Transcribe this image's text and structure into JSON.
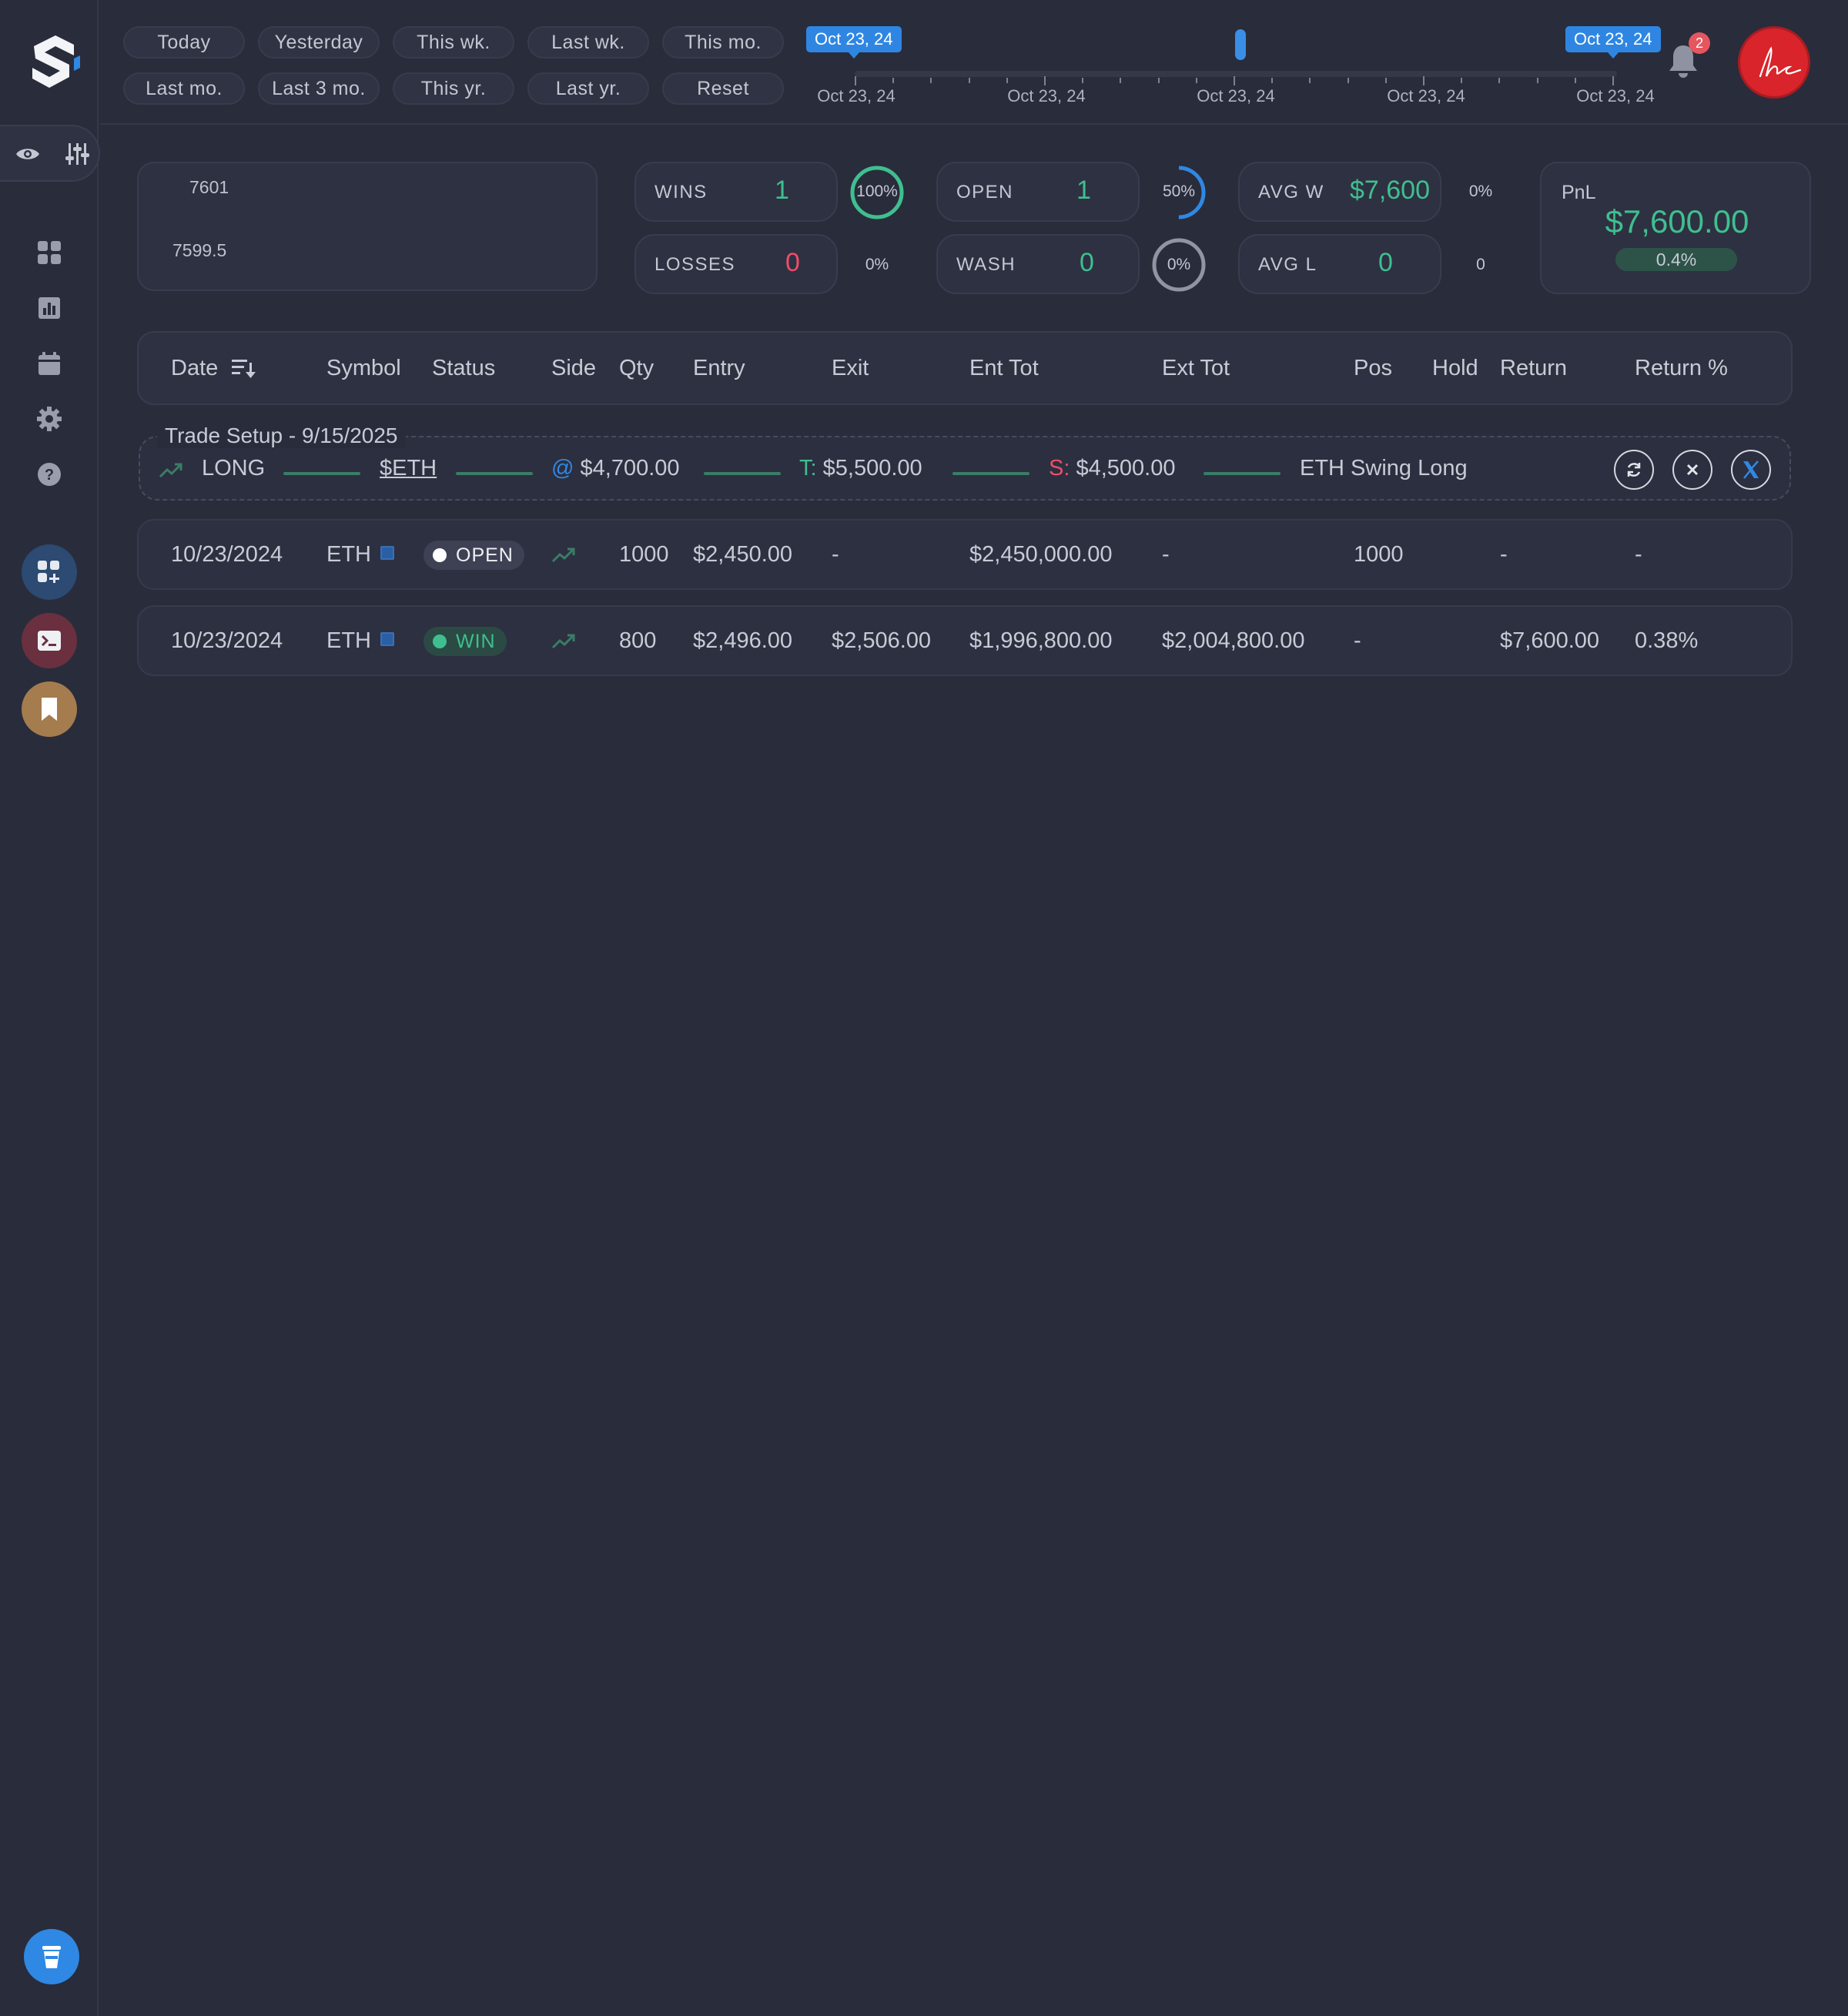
{
  "range_buttons": [
    "Today",
    "Yesterday",
    "This wk.",
    "Last wk.",
    "This mo.",
    "Last mo.",
    "Last 3 mo.",
    "This yr.",
    "Last yr.",
    "Reset"
  ],
  "slider": {
    "start_flag": "Oct 23, 24",
    "end_flag": "Oct 23, 24",
    "tick_labels": [
      "Oct 23, 24",
      "Oct 23, 24",
      "Oct 23, 24",
      "Oct 23, 24",
      "Oct 23, 24"
    ]
  },
  "notifications": {
    "count": "2"
  },
  "mini_chart": {
    "high": "7601",
    "low": "7599.5"
  },
  "stats": {
    "wins": {
      "label": "WINS",
      "value": "1",
      "pct": "100%"
    },
    "losses": {
      "label": "LOSSES",
      "value": "0",
      "pct": "0%"
    },
    "open": {
      "label": "OPEN",
      "value": "1",
      "pct": "50%"
    },
    "wash": {
      "label": "WASH",
      "value": "0",
      "pct": "0%"
    },
    "avg_w": {
      "label": "AVG W",
      "value": "$7,600",
      "pct": "0%"
    },
    "avg_l": {
      "label": "AVG L",
      "value": "0",
      "pct": "0"
    },
    "win_ring_level": 1.0,
    "open_ring_level": 0.5
  },
  "pnl": {
    "label": "PnL",
    "value": "$7,600.00",
    "pct": "0.4%"
  },
  "table": {
    "headers": [
      "Date",
      "Symbol",
      "Status",
      "Side",
      "Qty",
      "Entry",
      "Exit",
      "Ent Tot",
      "Ext Tot",
      "Pos",
      "Hold",
      "Return",
      "Return %"
    ],
    "setup": {
      "title": "Trade Setup - 9/15/2025",
      "side": "LONG",
      "symbol": "$ETH",
      "entry_prefix": "@",
      "entry": "$4,700.00",
      "target_prefix": "T:",
      "target": "$5,500.00",
      "stop_prefix": "S:",
      "stop": "$4,500.00",
      "note": "ETH Swing Long"
    },
    "rows": [
      {
        "date": "10/23/2024",
        "symbol": "ETH",
        "status": "OPEN",
        "qty": "1000",
        "entry": "$2,450.00",
        "exit": "-",
        "ent_tot": "$2,450,000.00",
        "ext_tot": "-",
        "pos": "1000",
        "hold": "",
        "return": "-",
        "return_pct": "-"
      },
      {
        "date": "10/23/2024",
        "symbol": "ETH",
        "status": "WIN",
        "qty": "800",
        "entry": "$2,496.00",
        "exit": "$2,506.00",
        "ent_tot": "$1,996,800.00",
        "ext_tot": "$2,004,800.00",
        "pos": "-",
        "hold": "",
        "return": "$7,600.00",
        "return_pct": "0.38%"
      }
    ]
  },
  "colors": {
    "accent": "#2f88e3",
    "green": "#3fbf8f",
    "red": "#ef4d6a",
    "background": "#292c3b"
  }
}
